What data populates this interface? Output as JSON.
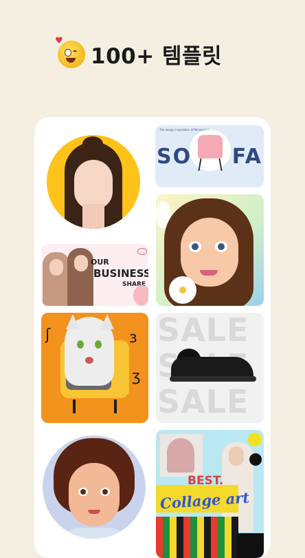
{
  "header": {
    "emoji_icon": "face-with-heart-and-tongue-emoji",
    "title": "100+ 템플릿"
  },
  "templates": [
    {
      "name": "portrait-girl-yellow-circle"
    },
    {
      "name": "sofa",
      "small_text": "The design inspiration of Minimalism",
      "word_left": "SO",
      "word_right": "FA"
    },
    {
      "name": "cartoon-girl-avatar"
    },
    {
      "name": "business",
      "line1": "OUR",
      "line2": "BUSINESS",
      "line3": "SHARE"
    },
    {
      "name": "cat-tv"
    },
    {
      "name": "sale-sneaker",
      "word": "SALE"
    },
    {
      "name": "cartoon-boy-avatar"
    },
    {
      "name": "collage-art",
      "line1": "BEST.",
      "line2": "Collage art"
    }
  ],
  "colors": {
    "background": "#F4EFE1",
    "card": "#FFFFFF",
    "accent_yellow": "#FFC21A",
    "sofa_blue": "#2E4A80"
  }
}
